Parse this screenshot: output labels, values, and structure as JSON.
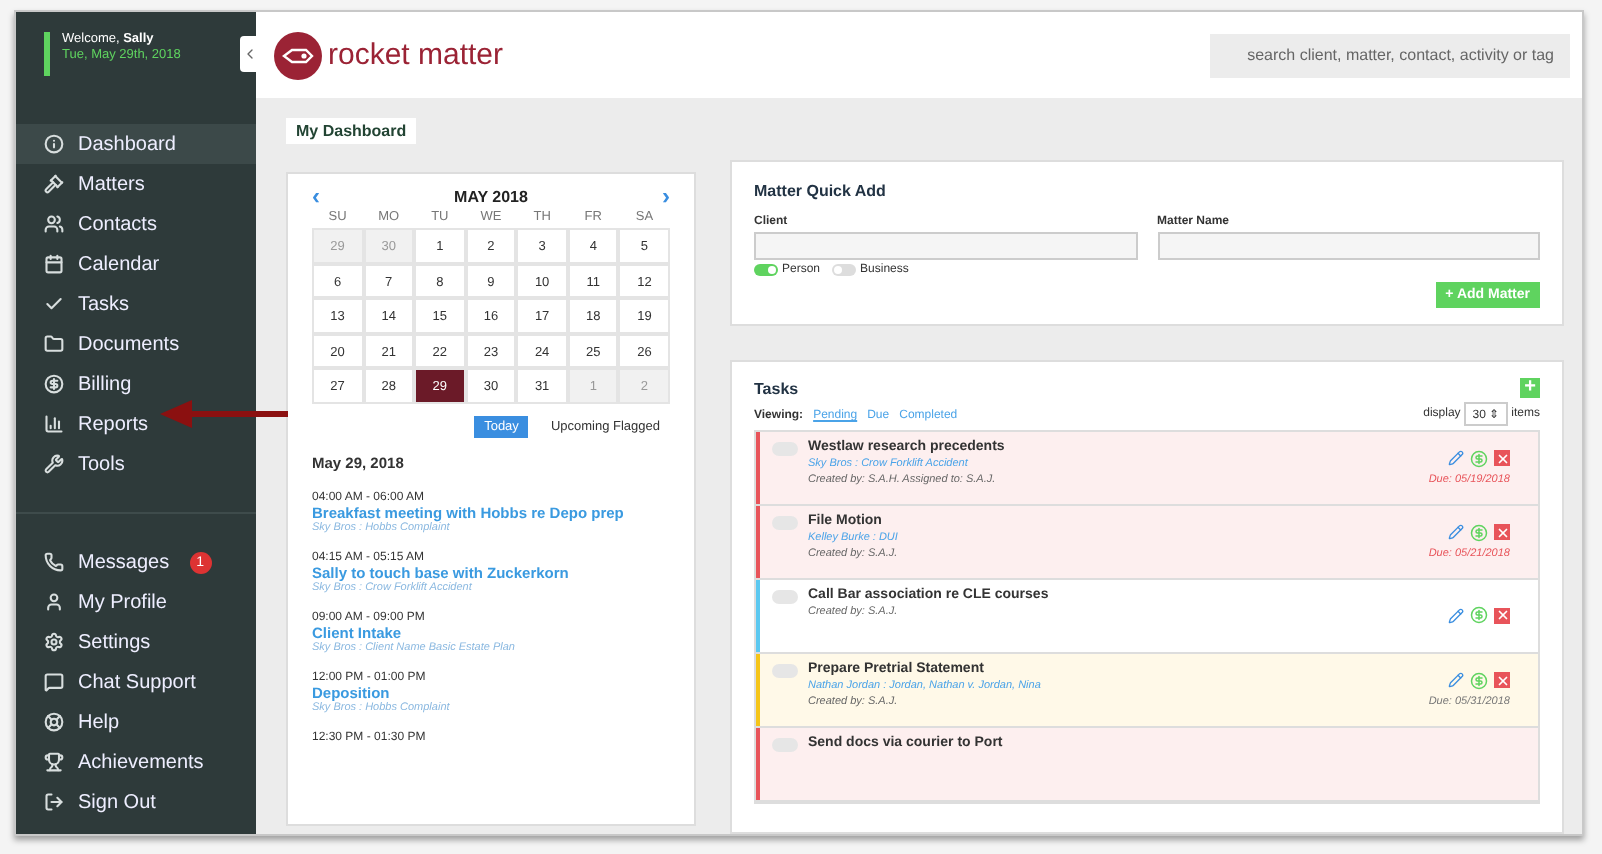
{
  "welcome": {
    "greeting": "Welcome,",
    "user": "Sally",
    "date": "Tue, May 29th, 2018"
  },
  "logo": {
    "text": "rocket matter"
  },
  "search": {
    "placeholder": "search client, matter, contact, activity or tag"
  },
  "sidebar": {
    "items": [
      {
        "label": "Dashboard",
        "selected": true,
        "kind": "info"
      },
      {
        "label": "Matters",
        "selected": false,
        "kind": "gavel"
      },
      {
        "label": "Contacts",
        "selected": false,
        "kind": "people"
      },
      {
        "label": "Calendar",
        "selected": false,
        "kind": "calendar"
      },
      {
        "label": "Tasks",
        "selected": false,
        "kind": "check"
      },
      {
        "label": "Documents",
        "selected": false,
        "kind": "folder"
      },
      {
        "label": "Billing",
        "selected": false,
        "kind": "dollar"
      },
      {
        "label": "Reports",
        "selected": false,
        "kind": "chart"
      },
      {
        "label": "Tools",
        "selected": false,
        "kind": "wrench"
      }
    ],
    "bottom_items": [
      {
        "label": "Messages",
        "selected": false,
        "kind": "phone",
        "badge": "1"
      },
      {
        "label": "My Profile",
        "selected": false,
        "kind": "user"
      },
      {
        "label": "Settings",
        "selected": false,
        "kind": "gear"
      },
      {
        "label": "Chat Support",
        "selected": false,
        "kind": "chat"
      },
      {
        "label": "Help",
        "selected": false,
        "kind": "help"
      },
      {
        "label": "Achievements",
        "selected": false,
        "kind": "trophy"
      },
      {
        "label": "Sign Out",
        "selected": false,
        "kind": "signout"
      }
    ]
  },
  "page_tab": "My Dashboard",
  "calendar": {
    "month": "MAY 2018",
    "prev": "‹",
    "next": "›",
    "weekdays": [
      "SU",
      "MO",
      "TU",
      "WE",
      "TH",
      "FR",
      "SA"
    ],
    "weeks": [
      [
        {
          "day": "29",
          "other_month": true,
          "selected": false
        },
        {
          "day": "30",
          "other_month": true,
          "selected": false
        },
        {
          "day": "1",
          "other_month": false,
          "selected": false
        },
        {
          "day": "2",
          "other_month": false,
          "selected": false
        },
        {
          "day": "3",
          "other_month": false,
          "selected": false
        },
        {
          "day": "4",
          "other_month": false,
          "selected": false
        },
        {
          "day": "5",
          "other_month": false,
          "selected": false
        }
      ],
      [
        {
          "day": "6",
          "other_month": false,
          "selected": false
        },
        {
          "day": "7",
          "other_month": false,
          "selected": false
        },
        {
          "day": "8",
          "other_month": false,
          "selected": false
        },
        {
          "day": "9",
          "other_month": false,
          "selected": false
        },
        {
          "day": "10",
          "other_month": false,
          "selected": false
        },
        {
          "day": "11",
          "other_month": false,
          "selected": false
        },
        {
          "day": "12",
          "other_month": false,
          "selected": false
        }
      ],
      [
        {
          "day": "13",
          "other_month": false,
          "selected": false
        },
        {
          "day": "14",
          "other_month": false,
          "selected": false
        },
        {
          "day": "15",
          "other_month": false,
          "selected": false
        },
        {
          "day": "16",
          "other_month": false,
          "selected": false
        },
        {
          "day": "17",
          "other_month": false,
          "selected": false
        },
        {
          "day": "18",
          "other_month": false,
          "selected": false
        },
        {
          "day": "19",
          "other_month": false,
          "selected": false
        }
      ],
      [
        {
          "day": "20",
          "other_month": false,
          "selected": false
        },
        {
          "day": "21",
          "other_month": false,
          "selected": false
        },
        {
          "day": "22",
          "other_month": false,
          "selected": false
        },
        {
          "day": "23",
          "other_month": false,
          "selected": false
        },
        {
          "day": "24",
          "other_month": false,
          "selected": false
        },
        {
          "day": "25",
          "other_month": false,
          "selected": false
        },
        {
          "day": "26",
          "other_month": false,
          "selected": false
        }
      ],
      [
        {
          "day": "27",
          "other_month": false,
          "selected": false
        },
        {
          "day": "28",
          "other_month": false,
          "selected": false
        },
        {
          "day": "29",
          "other_month": false,
          "selected": true
        },
        {
          "day": "30",
          "other_month": false,
          "selected": false
        },
        {
          "day": "31",
          "other_month": false,
          "selected": false
        },
        {
          "day": "1",
          "other_month": true,
          "selected": false
        },
        {
          "day": "2",
          "other_month": true,
          "selected": false
        }
      ]
    ],
    "tabs": [
      {
        "label": "Today",
        "selected": true
      },
      {
        "label": "Upcoming Flagged",
        "selected": false
      }
    ],
    "date_heading": "May 29, 2018",
    "events": [
      {
        "time": "04:00 AM - 06:00 AM",
        "title": "Breakfast meeting with Hobbs re Depo prep",
        "matter": "Sky Bros : Hobbs Complaint"
      },
      {
        "time": "04:15 AM - 05:15 AM",
        "title": "Sally to touch base with Zuckerkorn",
        "matter": "Sky Bros : Crow Forklift Accident"
      },
      {
        "time": "09:00 AM - 09:00 PM",
        "title": "Client Intake",
        "matter": "Sky Bros : Client Name Basic Estate Plan"
      },
      {
        "time": "12:00 PM - 01:00 PM",
        "title": "Deposition",
        "matter": "Sky Bros : Hobbs Complaint"
      },
      {
        "time": "12:30 PM - 01:30 PM"
      }
    ]
  },
  "quick_add": {
    "title": "Matter Quick Add",
    "client_label": "Client",
    "matter_label": "Matter Name",
    "toggles": [
      {
        "label": "Person",
        "on": true
      },
      {
        "label": "Business",
        "on": false
      }
    ],
    "button": "+ Add Matter"
  },
  "tasks": {
    "title": "Tasks",
    "add": "+",
    "viewing_label": "Viewing:",
    "filters": [
      {
        "label": "Pending",
        "selected": true
      },
      {
        "label": "Due",
        "selected": false
      },
      {
        "label": "Completed",
        "selected": false
      }
    ],
    "display_label": "display",
    "display_value": "30",
    "display_arrow": "⇕",
    "display_suffix": "items",
    "items": [
      {
        "title": "Westlaw research precedents",
        "matter": "Sky Bros : Crow Forklift Accident",
        "meta": "Created by: S.A.H. Assigned to: S.A.J.",
        "due": "Due: 05/19/2018",
        "done": false,
        "color": "#e8545a",
        "overdue": true
      },
      {
        "title": "File Motion",
        "matter": "Kelley Burke : DUI",
        "meta": "Created by: S.A.J.",
        "due": "Due: 05/21/2018",
        "done": false,
        "color": "#e8545a",
        "overdue": true
      },
      {
        "title": "Call Bar association re CLE courses",
        "meta": "Created by: S.A.J.",
        "done": false,
        "color": "#5bc8f0",
        "overdue": false
      },
      {
        "title": "Prepare Pretrial Statement",
        "matter": "Nathan Jordan : Jordan, Nathan v. Jordan, Nina",
        "meta": "Created by: S.A.J.",
        "due": "Due: 05/31/2018",
        "done": false,
        "color": "#f5c518",
        "overdue": false
      },
      {
        "title": "Send docs via courier to Port",
        "done": false,
        "color": "#e8545a",
        "overdue": true
      }
    ]
  }
}
